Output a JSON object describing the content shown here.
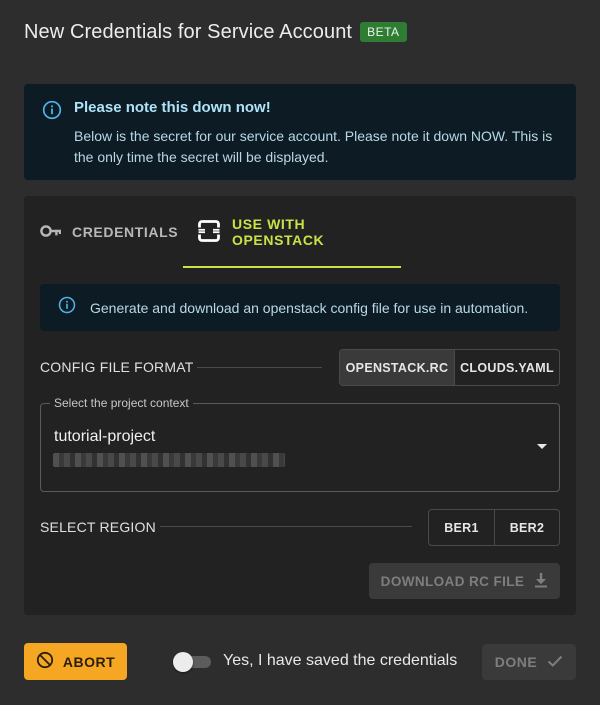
{
  "dialog": {
    "title": "New Credentials for Service Account",
    "badge": "BETA"
  },
  "note": {
    "icon": "info-icon",
    "title": "Please note this down now!",
    "text": "Below is the secret for our service account. Please note it down NOW. This is the only time the secret will be displayed."
  },
  "tabs": [
    {
      "label": "CREDENTIALS",
      "icon": "key-icon",
      "active": false
    },
    {
      "label": "USE WITH OPENSTACK",
      "icon": "openstack-icon",
      "active": true
    }
  ],
  "openstack": {
    "info_text": "Generate and download an openstack config file for use in automation.",
    "config_format": {
      "label": "CONFIG FILE FORMAT",
      "options": [
        "OPENSTACK.RC",
        "CLOUDS.YAML"
      ],
      "selected": "OPENSTACK.RC"
    },
    "project": {
      "legend": "Select the project context",
      "value": "tutorial-project"
    },
    "region": {
      "label": "SELECT REGION",
      "options": [
        "BER1",
        "BER2"
      ]
    },
    "download_label": "DOWNLOAD RC FILE"
  },
  "footer": {
    "abort_label": "ABORT",
    "confirm_label": "Yes, I have saved the credentials",
    "confirm_checked": false,
    "done_label": "DONE"
  },
  "colors": {
    "background": "#2d2d2d",
    "card": "#222222",
    "info_bg": "#0d1b24",
    "accent": "#c8e346",
    "beta": "#2f7d32",
    "abort": "#f5a623"
  }
}
